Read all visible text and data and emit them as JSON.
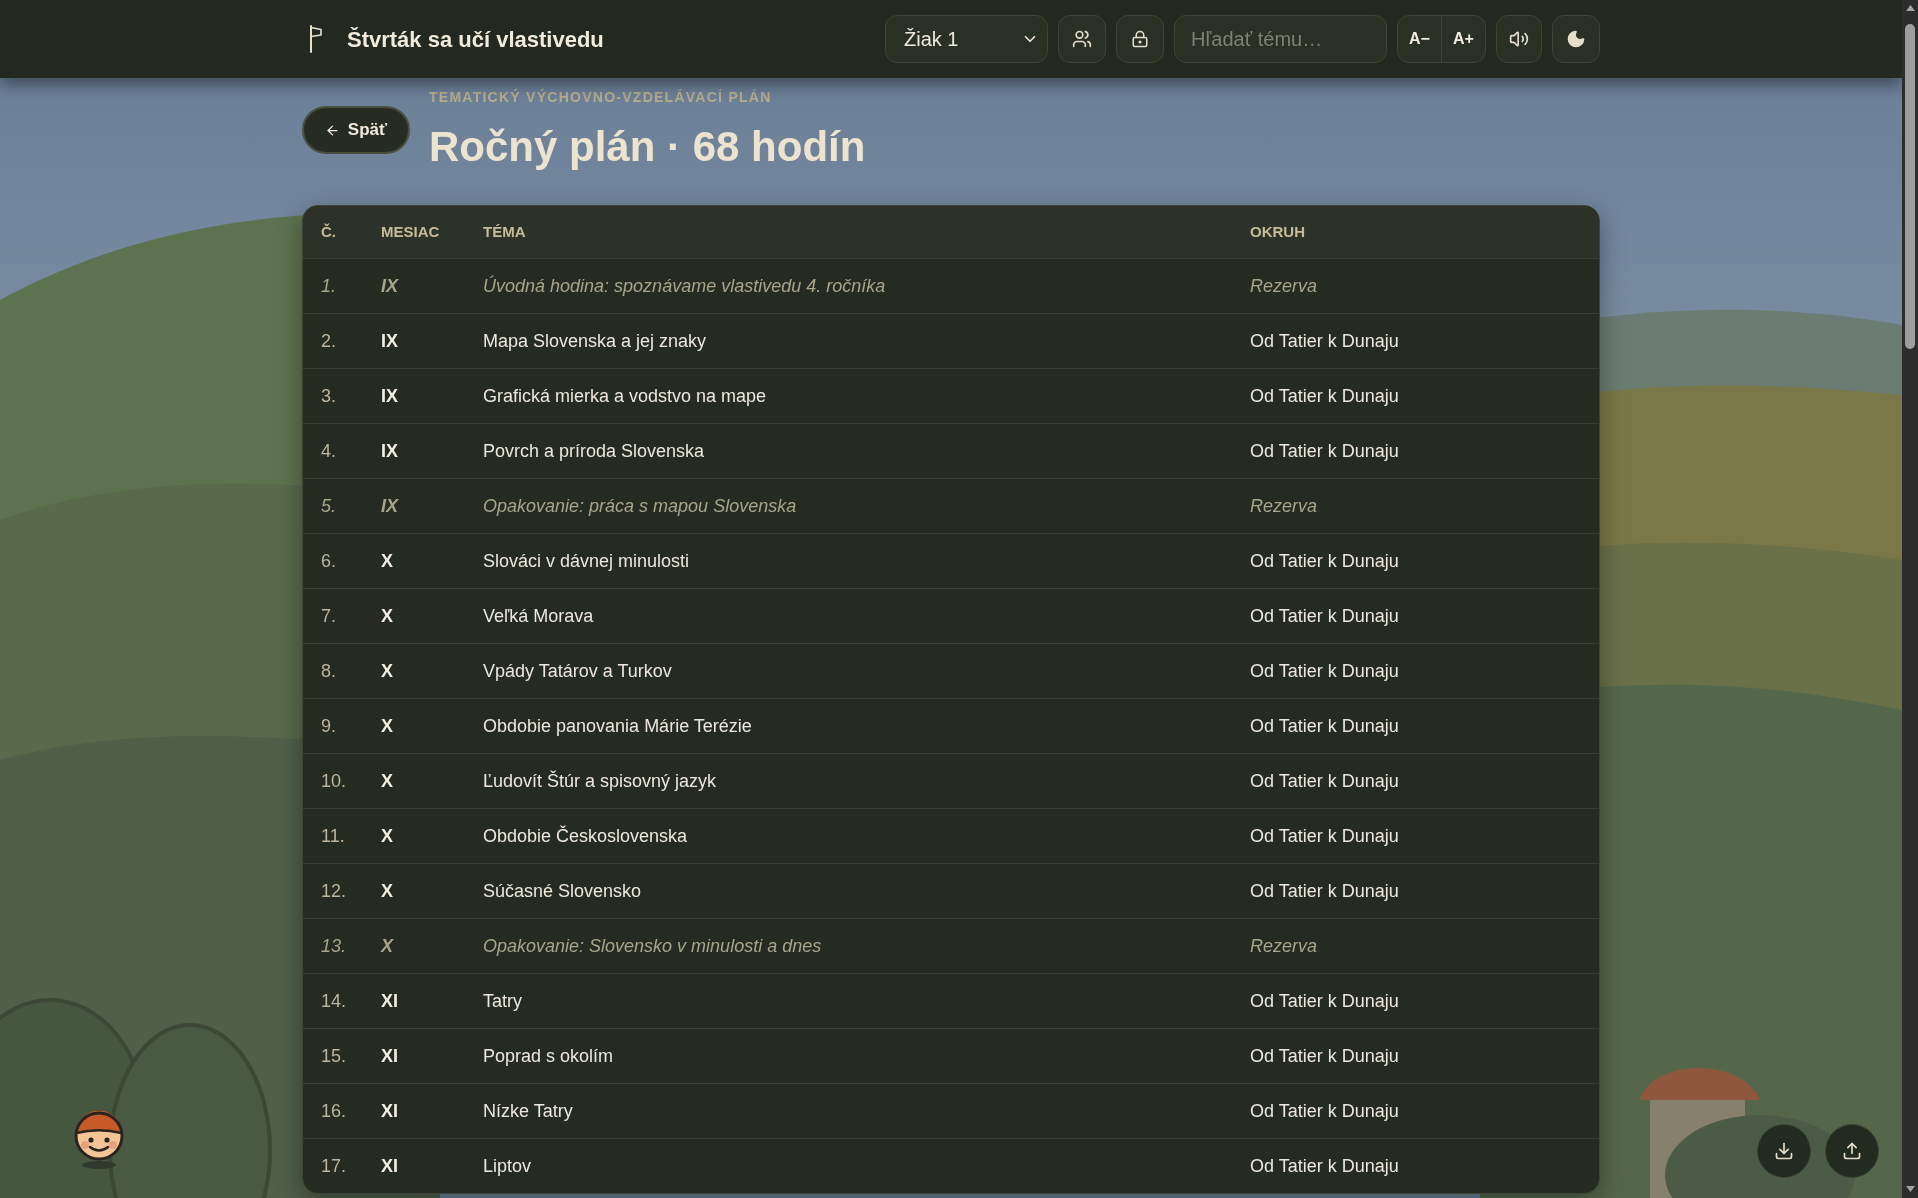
{
  "header": {
    "title": "Štvrták sa učí vlastivedu",
    "student_select": {
      "value": "Žiak 1"
    },
    "search": {
      "placeholder": "Hľadať tému…"
    },
    "font_buttons": [
      "A−",
      "A+"
    ]
  },
  "back_button": "Späť",
  "eyebrow": "TEMATICKÝ VÝCHOVNO-VZDELÁVACÍ PLÁN",
  "title": "Ročný plán · 68 hodín",
  "table": {
    "columns": [
      "Č.",
      "MESIAC",
      "TÉMA",
      "OKRUH"
    ],
    "rows": [
      {
        "kind": "reserve",
        "number": "1.",
        "month": "IX",
        "topic": "Úvodná hodina: spoznávame vlastivedu 4. ročníka",
        "area": "Rezerva"
      },
      {
        "kind": "lesson",
        "number": "2.",
        "month": "IX",
        "topic": "Mapa Slovenska a jej znaky",
        "area": "Od Tatier k Dunaju"
      },
      {
        "kind": "lesson",
        "number": "3.",
        "month": "IX",
        "topic": "Grafická mierka a vodstvo na mape",
        "area": "Od Tatier k Dunaju"
      },
      {
        "kind": "lesson",
        "number": "4.",
        "month": "IX",
        "topic": "Povrch a príroda Slovenska",
        "area": "Od Tatier k Dunaju"
      },
      {
        "kind": "reserve",
        "number": "5.",
        "month": "IX",
        "topic": "Opakovanie: práca s mapou Slovenska",
        "area": "Rezerva"
      },
      {
        "kind": "lesson",
        "number": "6.",
        "month": "X",
        "topic": "Slováci v dávnej minulosti",
        "area": "Od Tatier k Dunaju"
      },
      {
        "kind": "lesson",
        "number": "7.",
        "month": "X",
        "topic": "Veľká Morava",
        "area": "Od Tatier k Dunaju"
      },
      {
        "kind": "lesson",
        "number": "8.",
        "month": "X",
        "topic": "Vpády Tatárov a Turkov",
        "area": "Od Tatier k Dunaju"
      },
      {
        "kind": "lesson",
        "number": "9.",
        "month": "X",
        "topic": "Obdobie panovania Márie Terézie",
        "area": "Od Tatier k Dunaju"
      },
      {
        "kind": "lesson",
        "number": "10.",
        "month": "X",
        "topic": "Ľudovít Štúr a spisovný jazyk",
        "area": "Od Tatier k Dunaju"
      },
      {
        "kind": "lesson",
        "number": "11.",
        "month": "X",
        "topic": "Obdobie Československa",
        "area": "Od Tatier k Dunaju"
      },
      {
        "kind": "lesson",
        "number": "12.",
        "month": "X",
        "topic": "Súčasné Slovensko",
        "area": "Od Tatier k Dunaju"
      },
      {
        "kind": "reserve",
        "number": "13.",
        "month": "X",
        "topic": "Opakovanie: Slovensko v minulosti a dnes",
        "area": "Rezerva"
      },
      {
        "kind": "lesson",
        "number": "14.",
        "month": "XI",
        "topic": "Tatry",
        "area": "Od Tatier k Dunaju"
      },
      {
        "kind": "lesson",
        "number": "15.",
        "month": "XI",
        "topic": "Poprad s okolím",
        "area": "Od Tatier k Dunaju"
      },
      {
        "kind": "lesson",
        "number": "16.",
        "month": "XI",
        "topic": "Nízke Tatry",
        "area": "Od Tatier k Dunaju"
      },
      {
        "kind": "lesson",
        "number": "17.",
        "month": "XI",
        "topic": "Liptov",
        "area": "Od Tatier k Dunaju"
      }
    ]
  }
}
